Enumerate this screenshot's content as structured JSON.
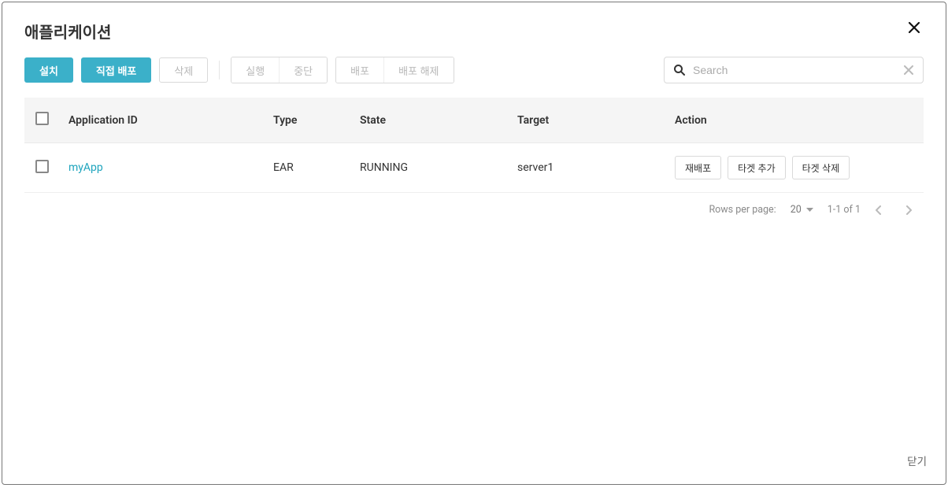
{
  "modal": {
    "title": "애플리케이션",
    "close_label": "닫기"
  },
  "toolbar": {
    "install": "설치",
    "direct_deploy": "직접 배포",
    "delete": "삭제",
    "run": "실행",
    "stop": "중단",
    "deploy": "배포",
    "undeploy": "배포 해제"
  },
  "search": {
    "placeholder": "Search"
  },
  "table": {
    "headers": {
      "app_id": "Application ID",
      "type": "Type",
      "state": "State",
      "target": "Target",
      "action": "Action"
    },
    "rows": [
      {
        "app_id": "myApp",
        "type": "EAR",
        "state": "RUNNING",
        "target": "server1",
        "actions": {
          "redeploy": "재배포",
          "add_target": "타겟 추가",
          "delete_target": "타겟 삭제"
        }
      }
    ]
  },
  "pagination": {
    "rows_per_page_label": "Rows per page:",
    "page_size": "20",
    "range": "1-1 of 1"
  }
}
